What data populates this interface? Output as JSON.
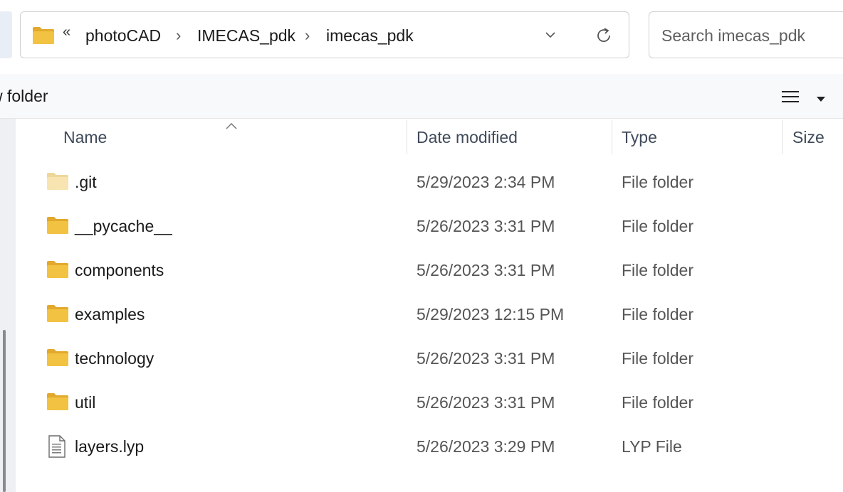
{
  "address_bar": {
    "overflow_glyph": "«",
    "breadcrumbs": [
      "photoCAD",
      "IMECAS_pdk",
      "imecas_pdk"
    ],
    "separator": "›"
  },
  "search": {
    "placeholder": "Search imecas_pdk"
  },
  "toolbar": {
    "new_folder_label": "w folder"
  },
  "columns": {
    "name": "Name",
    "date": "Date modified",
    "type": "Type",
    "size": "Size"
  },
  "files": [
    {
      "name": ".git",
      "date": "5/29/2023 2:34 PM",
      "type": "File folder",
      "icon": "folder-hidden-icon"
    },
    {
      "name": "__pycache__",
      "date": "5/26/2023 3:31 PM",
      "type": "File folder",
      "icon": "folder-icon"
    },
    {
      "name": "components",
      "date": "5/26/2023 3:31 PM",
      "type": "File folder",
      "icon": "folder-icon"
    },
    {
      "name": "examples",
      "date": "5/29/2023 12:15 PM",
      "type": "File folder",
      "icon": "folder-icon"
    },
    {
      "name": "technology",
      "date": "5/26/2023 3:31 PM",
      "type": "File folder",
      "icon": "folder-icon"
    },
    {
      "name": "util",
      "date": "5/26/2023 3:31 PM",
      "type": "File folder",
      "icon": "folder-icon"
    },
    {
      "name": "layers.lyp",
      "date": "5/26/2023 3:29 PM",
      "type": "LYP File",
      "icon": "file-icon"
    }
  ],
  "colors": {
    "folder": "#f2c242",
    "folder_dark": "#e3a92c",
    "folder_hidden": "#f7e4b0",
    "toolbar_bg": "#f8f9fb"
  }
}
